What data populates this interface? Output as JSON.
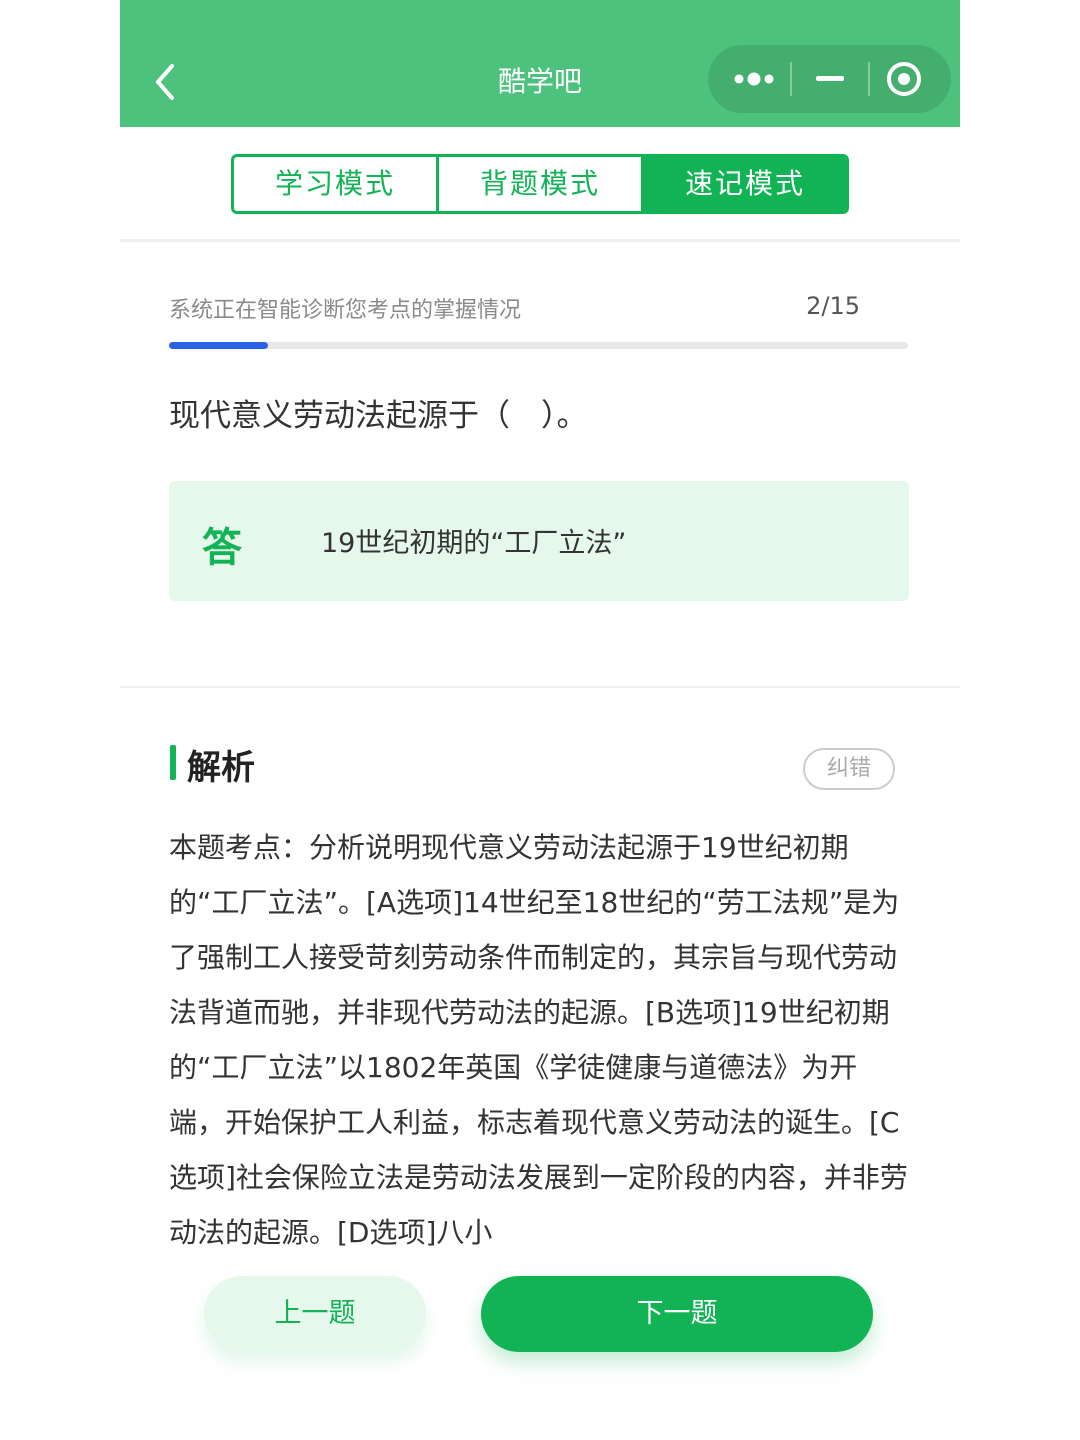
{
  "header": {
    "title": "酷学吧",
    "icons": [
      "chevron-left-icon",
      "more-dots-icon",
      "minimize-icon",
      "close-target-icon"
    ]
  },
  "modes": {
    "tabs": [
      "学习模式",
      "背题模式",
      "速记模式"
    ],
    "active_index": 2
  },
  "progress": {
    "text": "系统正在智能诊断您考点的掌握情况",
    "count": "2/15",
    "fraction": 0.1333
  },
  "question": {
    "text": "现代意义劳动法起源于（　）。"
  },
  "answer": {
    "mark": "答",
    "text": "19世纪初期的“工厂立法”"
  },
  "analysis": {
    "title": "解析",
    "report_label": "纠错",
    "body": "本题考点：分析说明现代意义劳动法起源于19世纪初期的“工厂立法”。[A选项]14世纪至18世纪的“劳工法规”是为了强制工人接受苛刻劳动条件而制定的，其宗旨与现代劳动法背道而驰，并非现代劳动法的起源。[B选项]19世纪初期的“工厂立法”以1802年英国《学徒健康与道德法》为开端，开始保护工人利益，标志着现代意义劳动法的诞生。[C选项]社会保险立法是劳动法发展到一定阶段的内容，并非劳动法的起源。[D选项]八小"
  },
  "footer": {
    "prev_label": "上一题",
    "next_label": "下一题"
  },
  "colors": {
    "header_green": "#4cc27c",
    "accent_green": "#12b355",
    "answer_bg": "#e6f7ec",
    "progress_blue": "#2b63e6"
  }
}
